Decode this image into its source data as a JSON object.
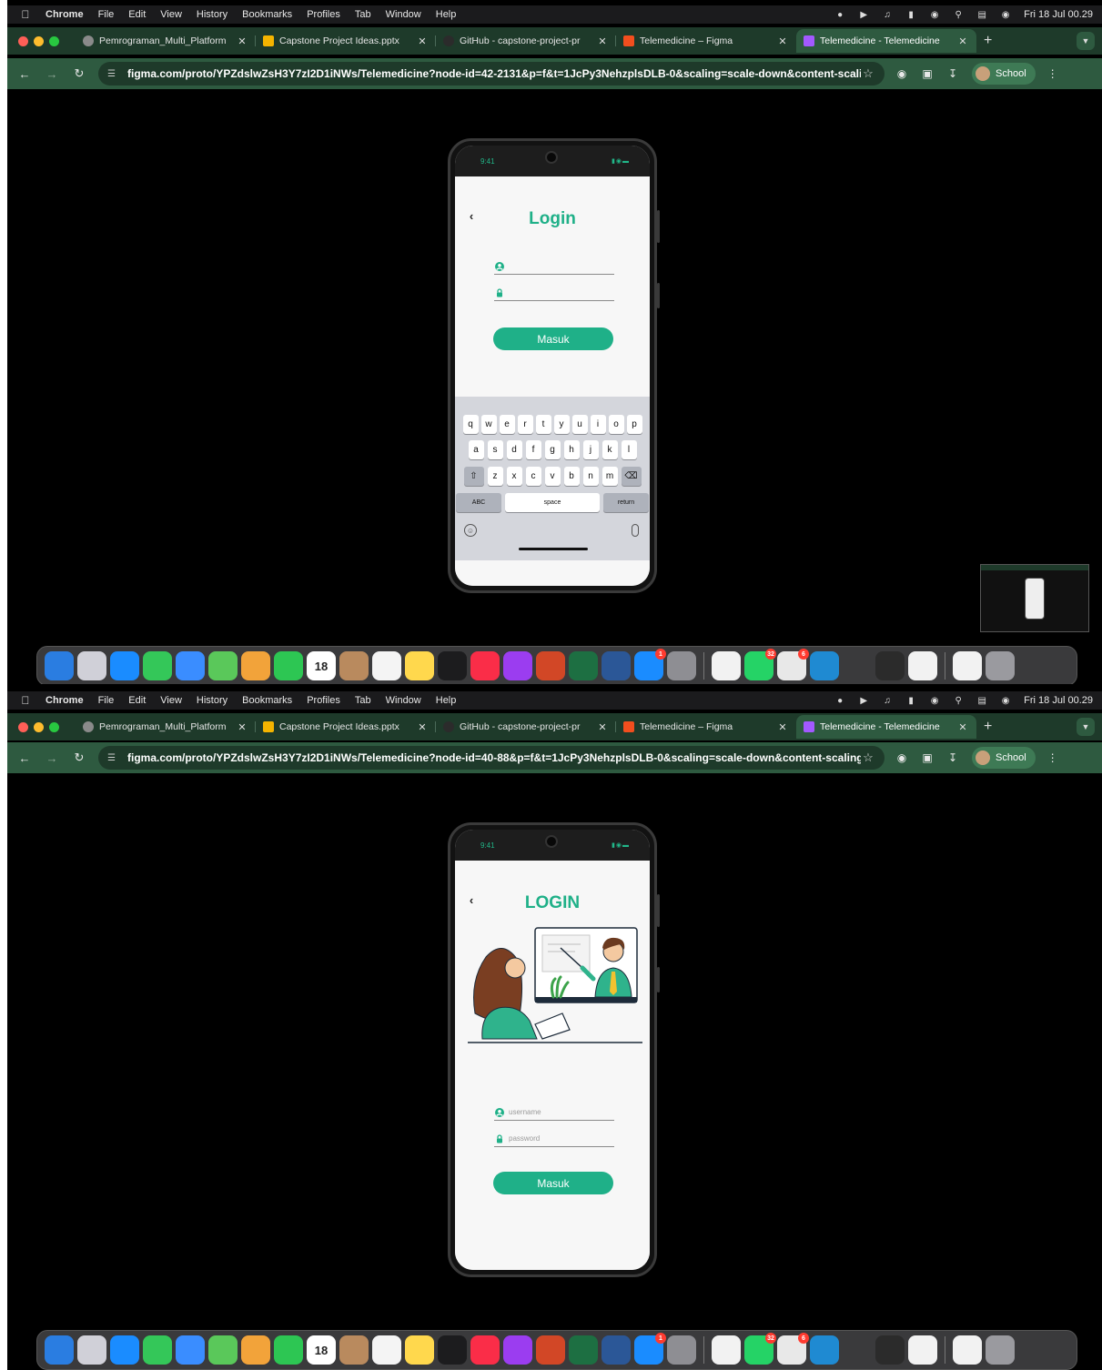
{
  "menubar": {
    "app": "Chrome",
    "items": [
      "File",
      "Edit",
      "View",
      "History",
      "Bookmarks",
      "Profiles",
      "Tab",
      "Window",
      "Help"
    ],
    "clock": "Fri 18 Jul 00.29"
  },
  "tabs": [
    {
      "title": "Pemrograman_Multi_Platform",
      "icon": "globe-icon",
      "color": "#8a8a8a"
    },
    {
      "title": "Capstone Project Ideas.pptx",
      "icon": "slides-icon",
      "color": "#f4b400"
    },
    {
      "title": "GitHub - capstone-project-pr",
      "icon": "github-icon",
      "color": "#2b2b2b"
    },
    {
      "title": "Telemedicine – Figma",
      "icon": "figma-icon",
      "color": "#f24e1e"
    },
    {
      "title": "Telemedicine - Telemedicine",
      "icon": "figma-icon",
      "color": "#a259ff"
    }
  ],
  "profile": "School",
  "screens": [
    {
      "url": "figma.com/proto/YPZdslwZsH3Y7zI2D1iNWs/Telemedicine?node-id=42-2131&p=f&t=1JcPy3NehzplsDLB-0&scaling=scale-down&content-scalin...",
      "time": "9:41",
      "title": "Login",
      "username_placeholder": "",
      "password_placeholder": "",
      "button": "Masuk"
    },
    {
      "url": "figma.com/proto/YPZdslwZsH3Y7zI2D1iNWs/Telemedicine?node-id=40-88&p=f&t=1JcPy3NehzplsDLB-0&scaling=scale-down&content-scaling...",
      "time": "9:41",
      "title": "LOGIN",
      "username_placeholder": "username",
      "password_placeholder": "password",
      "button": "Masuk"
    }
  ],
  "keyboard": {
    "row1": [
      "q",
      "w",
      "e",
      "r",
      "t",
      "y",
      "u",
      "i",
      "o",
      "p"
    ],
    "row2": [
      "a",
      "s",
      "d",
      "f",
      "g",
      "h",
      "j",
      "k",
      "l"
    ],
    "row3": [
      "z",
      "x",
      "c",
      "v",
      "b",
      "n",
      "m"
    ],
    "abc": "ABC",
    "space": "space",
    "return": "return"
  },
  "dock": {
    "calendar_day": "18",
    "badges": {
      "appstore": "1",
      "whatsapp": "32",
      "office": "6"
    },
    "apps": [
      {
        "name": "finder",
        "color": "#2a7de1"
      },
      {
        "name": "launchpad",
        "color": "#d0d0d8"
      },
      {
        "name": "safari",
        "color": "#1a8cff"
      },
      {
        "name": "messages",
        "color": "#34c759"
      },
      {
        "name": "mail",
        "color": "#3a8dff"
      },
      {
        "name": "maps",
        "color": "#5ac85a"
      },
      {
        "name": "photos",
        "color": "#f2a33a"
      },
      {
        "name": "facetime",
        "color": "#2dc653"
      },
      {
        "name": "calendar",
        "color": "#ffffff"
      },
      {
        "name": "contacts",
        "color": "#b98a5e"
      },
      {
        "name": "reminders",
        "color": "#f4f4f4"
      },
      {
        "name": "notes",
        "color": "#ffd84d"
      },
      {
        "name": "appletv",
        "color": "#1c1c1e"
      },
      {
        "name": "music",
        "color": "#fa2d48"
      },
      {
        "name": "podcasts",
        "color": "#9b3df0"
      },
      {
        "name": "powerpoint",
        "color": "#d24726"
      },
      {
        "name": "excel",
        "color": "#1d6f42"
      },
      {
        "name": "word",
        "color": "#2b5797"
      },
      {
        "name": "appstore",
        "color": "#1a8cff"
      },
      {
        "name": "settings",
        "color": "#8e8e93"
      },
      {
        "name": "chrome",
        "color": "#f2f2f2"
      },
      {
        "name": "whatsapp",
        "color": "#25d366"
      },
      {
        "name": "office",
        "color": "#e8e8e8"
      },
      {
        "name": "vscode",
        "color": "#1f8ad2"
      },
      {
        "name": "rocket",
        "color": "#3a3a3c"
      },
      {
        "name": "terminal",
        "color": "#2b2b2b"
      },
      {
        "name": "python",
        "color": "#f2f2f2"
      },
      {
        "name": "document",
        "color": "#f2f2f2"
      },
      {
        "name": "trash",
        "color": "#9a9a9f"
      }
    ]
  },
  "colors": {
    "accent": "#1fb088",
    "chrome_frame": "#1e3a2a",
    "chrome_toolbar": "#2e5a40"
  }
}
